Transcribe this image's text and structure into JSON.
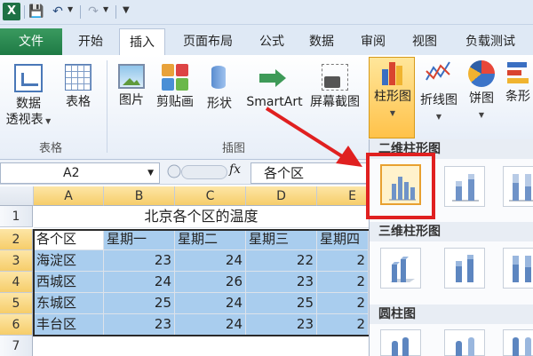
{
  "app": {
    "logo_letter": "X"
  },
  "tabs": [
    {
      "label": "文件"
    },
    {
      "label": "开始"
    },
    {
      "label": "插入"
    },
    {
      "label": "页面布局"
    },
    {
      "label": "公式"
    },
    {
      "label": "数据"
    },
    {
      "label": "审阅"
    },
    {
      "label": "视图"
    },
    {
      "label": "负载测试"
    }
  ],
  "ribbon": {
    "pivot_label_1": "数据",
    "pivot_label_2": "透视表",
    "table_label": "表格",
    "group_tables": "表格",
    "picture_label": "图片",
    "clipart_label": "剪贴画",
    "shape_label": "形状",
    "smartart_label": "SmartArt",
    "screenshot_label": "屏幕截图",
    "group_illustrations": "插图",
    "column_chart_label": "柱形图",
    "line_chart_label": "折线图",
    "pie_chart_label": "饼图",
    "bar_chart_label": "条形"
  },
  "formula_bar": {
    "name_box": "A2",
    "fx_label": "fx",
    "value": "各个区"
  },
  "sheet": {
    "columns": [
      "A",
      "B",
      "C",
      "D",
      "E"
    ],
    "rows": [
      "1",
      "2",
      "3",
      "4",
      "5",
      "6",
      "7"
    ],
    "title": "北京各个区的温度",
    "header": [
      "各个区",
      "星期一",
      "星期二",
      "星期三",
      "星期四"
    ],
    "data": [
      [
        "海淀区",
        "23",
        "24",
        "22",
        "2"
      ],
      [
        "西城区",
        "24",
        "26",
        "23",
        "2"
      ],
      [
        "东城区",
        "25",
        "24",
        "25",
        "2"
      ],
      [
        "丰台区",
        "23",
        "24",
        "23",
        "2"
      ]
    ]
  },
  "gallery": {
    "section_2d": "二维柱形图",
    "section_3d": "三维柱形图",
    "section_cylinder": "圆柱图"
  },
  "colors": {
    "file_tab": "#1e7a45",
    "selection_fill": "#a9cdee",
    "highlight_box": "#e02020",
    "active_chart_button": "#ffc24a"
  }
}
